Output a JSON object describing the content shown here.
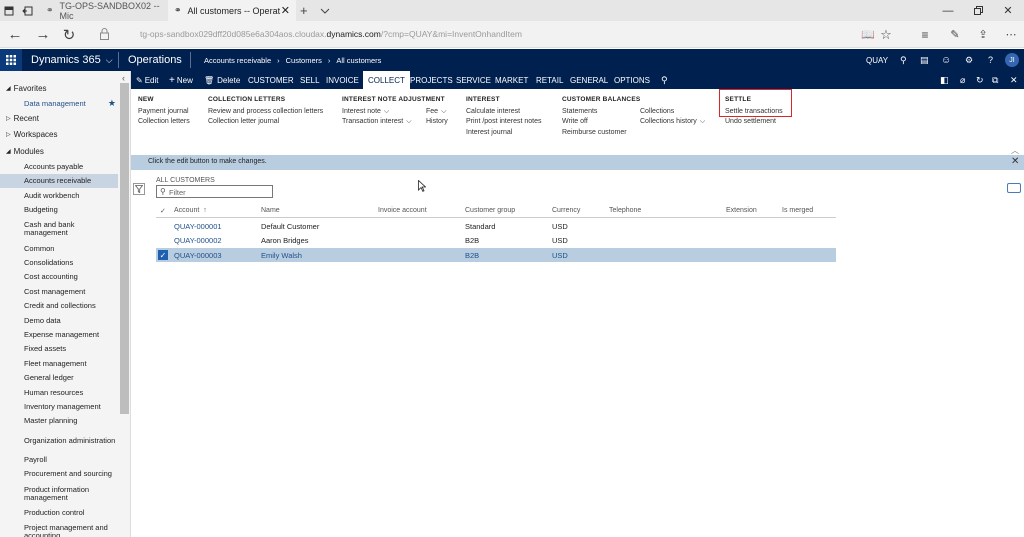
{
  "browser": {
    "tabs": [
      {
        "label": "TG-OPS-SANDBOX02 -- Mic"
      },
      {
        "label": "All customers -- Operat"
      }
    ],
    "url_prefix": "tg-ops-sandbox029dff20d085e6a304aos.cloudax.",
    "url_domain": "dynamics.com",
    "url_suffix": "/?cmp=QUAY&mi=InventOnhandItem"
  },
  "header": {
    "app_name": "Dynamics 365",
    "module": "Operations",
    "breadcrumb": [
      "Accounts receivable",
      "Customers",
      "All customers"
    ],
    "company": "QUAY",
    "avatar_initials": "JI"
  },
  "sidebar": {
    "favorites_label": "Favorites",
    "favorite_items": [
      {
        "label": "Data management"
      }
    ],
    "recent_label": "Recent",
    "workspaces_label": "Workspaces",
    "modules_label": "Modules",
    "modules": [
      {
        "label": "Accounts payable"
      },
      {
        "label": "Accounts receivable"
      },
      {
        "label": "Audit workbench"
      },
      {
        "label": "Budgeting"
      },
      {
        "label": "Cash and bank management"
      },
      {
        "label": "Common"
      },
      {
        "label": "Consolidations"
      },
      {
        "label": "Cost accounting"
      },
      {
        "label": "Cost management"
      },
      {
        "label": "Credit and collections"
      },
      {
        "label": "Demo data"
      },
      {
        "label": "Expense management"
      },
      {
        "label": "Fixed assets"
      },
      {
        "label": "Fleet management"
      },
      {
        "label": "General ledger"
      },
      {
        "label": "Human resources"
      },
      {
        "label": "Inventory management"
      },
      {
        "label": "Master planning"
      },
      {
        "label": "Organization administration"
      },
      {
        "label": "Payroll"
      },
      {
        "label": "Procurement and sourcing"
      },
      {
        "label": "Product information management"
      },
      {
        "label": "Production control"
      },
      {
        "label": "Project management and accounting"
      }
    ]
  },
  "actionbar": {
    "edit": "Edit",
    "new": "New",
    "delete": "Delete",
    "tabs": [
      "CUSTOMER",
      "SELL",
      "INVOICE",
      "COLLECT",
      "PROJECTS",
      "SERVICE",
      "MARKET",
      "RETAIL",
      "GENERAL",
      "OPTIONS"
    ]
  },
  "ribbon": {
    "new": {
      "title": "NEW",
      "items": [
        "Payment journal",
        "Collection letters"
      ]
    },
    "collection_letters": {
      "title": "COLLECTION LETTERS",
      "items": [
        "Review and process collection letters",
        "Collection letter journal"
      ]
    },
    "interest_note_adjustment": {
      "title": "INTEREST NOTE ADJUSTMENT",
      "items": [
        "Interest note",
        "Transaction interest",
        "Fee",
        "History"
      ]
    },
    "interest": {
      "title": "INTEREST",
      "items": [
        "Calculate interest",
        "Print /post interest notes",
        "Interest journal"
      ]
    },
    "customer_balances": {
      "title": "CUSTOMER BALANCES",
      "items": [
        "Statements",
        "Write off",
        "Reimburse customer",
        "Collections",
        "Collections history"
      ]
    },
    "settle": {
      "title": "SETTLE",
      "items": [
        "Settle transactions",
        "Undo settlement"
      ]
    }
  },
  "infobar": {
    "text": "Click the edit button to make changes."
  },
  "list": {
    "title": "ALL CUSTOMERS",
    "filter_placeholder": "Filter",
    "columns": [
      "Account",
      "Name",
      "Invoice account",
      "Customer group",
      "Currency",
      "Telephone",
      "Extension",
      "Is merged"
    ],
    "rows": [
      {
        "account": "QUAY-000001",
        "name": "Default Customer",
        "invoice_account": "",
        "customer_group": "Standard",
        "currency": "USD"
      },
      {
        "account": "QUAY-000002",
        "name": "Aaron Bridges",
        "invoice_account": "",
        "customer_group": "B2B",
        "currency": "USD"
      },
      {
        "account": "QUAY-000003",
        "name": "Emily Walsh",
        "invoice_account": "",
        "customer_group": "B2B",
        "currency": "USD"
      }
    ],
    "selected_row": 2
  },
  "colors": {
    "nav_dark": "#002050",
    "selection": "#b8cde0",
    "highlight_box": "#d9262b",
    "link": "#1f4f8b"
  }
}
